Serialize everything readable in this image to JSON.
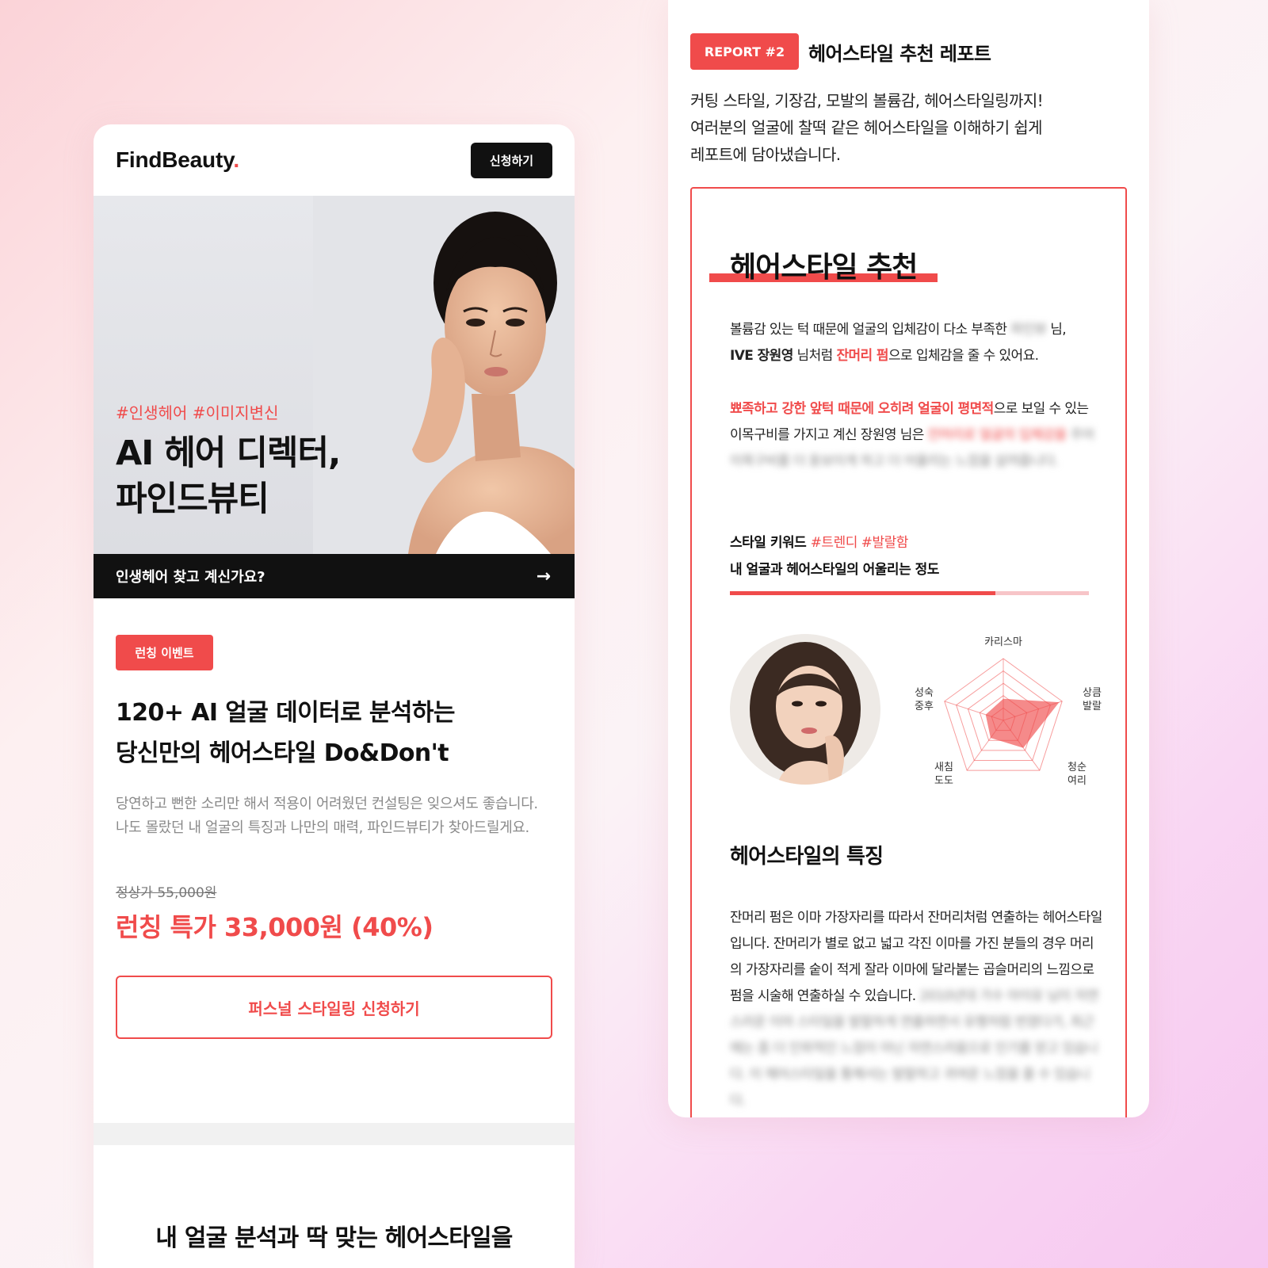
{
  "left": {
    "brand": "FindBeauty",
    "brand_dot": ".",
    "apply_button": "신청하기",
    "hero": {
      "tags": "#인생헤어 #이미지변신",
      "title_line1": "AI 헤어 디렉터,",
      "title_line2": "파인드뷰티",
      "bar_text": "인생헤어 찾고 계신가요?",
      "bar_arrow": "→"
    },
    "event_badge": "런칭 이벤트",
    "main_title_line1": "120+ AI 얼굴 데이터로 분석하는",
    "main_title_line2": "당신만의 헤어스타일 Do&Don't",
    "description": "당연하고 뻔한 소리만 해서 적용이 어려웠던 컨설팅은 잊으셔도 좋습니다. 나도 몰랐던 내 얼굴의 특징과 나만의 매력, 파인드뷰티가 찾아드릴게요.",
    "price_original": "정상가 55,000원",
    "price_sale": "런칭 특가 33,000원 (40%)",
    "cta_button": "퍼스널 스타일링 신청하기",
    "section2_title": "내 얼굴 분석과 딱 맞는 헤어스타일을"
  },
  "right": {
    "report_badge": "REPORT #2",
    "report_title": "헤어스타일 추천 레포트",
    "intro_line1": "커팅 스타일, 기장감, 모발의 볼륨감, 헤어스타일링까지!",
    "intro_line2": "여러분의 얼굴에 찰떡 같은 헤어스타일을 이해하기 쉽게",
    "intro_line3": "레포트에 담아냈습니다.",
    "box": {
      "heading": "헤어스타일 추천",
      "p1_a": "볼륨감 있는 턱 때문에 얼굴의 입체감이 다소 부족한 ",
      "p1_blur": "파인뷰",
      "p1_b": " 님,",
      "p1_c_bold": "IVE 장원영",
      "p1_d": " 님처럼 ",
      "p1_e_red": "잔머리 펌",
      "p1_f": "으로 입체감을 줄 수 있어요.",
      "p2_red": "뾰족하고 강한 앞턱 때문에 오히려 얼굴이 평면적",
      "p2_a": "으로 보일 수 있는 이목구비를 가지고 계신 장원영 님은 ",
      "p2_blur_red": "잔머리로 얼굴의 입체감을",
      "p2_blur": " 주어 이목구비를 더 돋보이게 하고 더 어울리는 느낌을 살려줍니다.",
      "keyword_label": "스타일 키워드 ",
      "keyword_tags": "#트렌디 #발랄함",
      "match_label": "내 얼굴과 헤어스타일의 어울리는 정도",
      "match_fraction": 0.74,
      "radar_labels": {
        "top": "카리스마",
        "right_1": "상큼",
        "right_2": "발랄",
        "bottom_right_1": "청순",
        "bottom_right_2": "여리",
        "bottom_left_1": "새침",
        "bottom_left_2": "도도",
        "left_1": "성숙",
        "left_2": "중후"
      },
      "radar_values": [
        0.35,
        0.95,
        0.55,
        0.35,
        0.3
      ],
      "subheading": "헤어스타일의 특징",
      "p3": "잔머리 펌은 이마 가장자리를 따라서 잔머리처럼 연출하는 헤어스타일입니다. 잔머리가 별로 없고 넓고 각진 이마를 가진 분들의 경우 머리의 가장자리를 숱이 적게 잘라 이마에 달라붙는 곱슬머리의 느낌으로 펌을 시술해 연출하실 수 있습니다.",
      "p3_blur": " 2010년대 가수 아이유 님이 자연스러운 이마 스타일을 발랄하게 연출하면서 유행처럼 번졌다가, 최근에는 좀 더 인위적인 느낌이 아닌 자연스러움으로 인기를 얻고 있습니다. 이 헤어스타일을 통해서는 발랄하고 귀여운 느낌을 줄 수 있습니다."
    }
  },
  "colors": {
    "accent": "#f04b4b",
    "dark": "#111111",
    "match_track": "#f7c5c8"
  }
}
